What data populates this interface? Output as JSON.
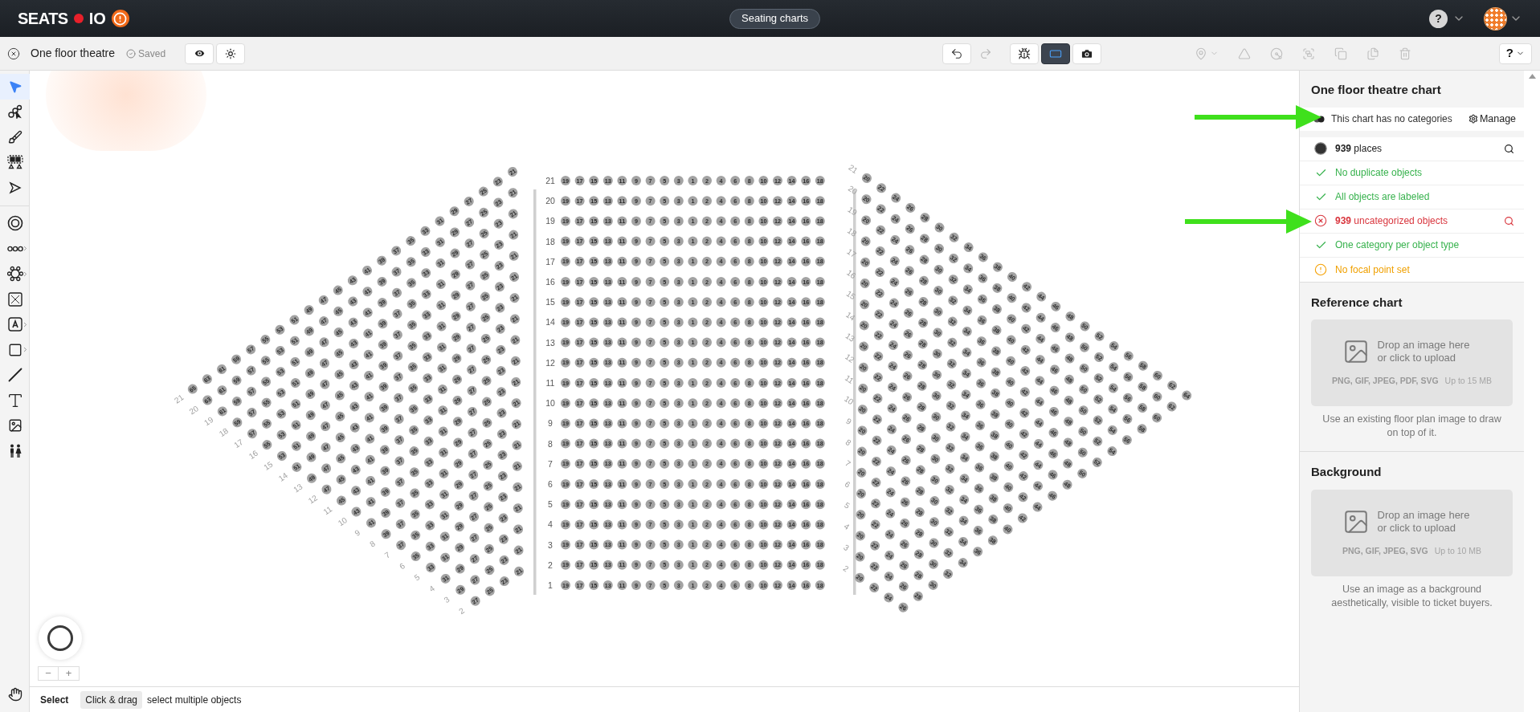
{
  "header": {
    "logo_left": "SEATS",
    "logo_right": "IO",
    "nav_tab": "Seating charts",
    "help": "?"
  },
  "toolbar": {
    "chart_name": "One floor theatre",
    "save_status": "Saved",
    "help": "?",
    "canvas_modes": [
      {
        "kind": "spark",
        "selected": false
      },
      {
        "kind": "frame",
        "selected": true
      },
      {
        "kind": "camera",
        "selected": false
      }
    ],
    "history": [
      {
        "kind": "undo",
        "disabled": false
      },
      {
        "kind": "redo",
        "disabled": true
      }
    ],
    "object_actions": [
      {
        "kind": "pin",
        "disabled": true,
        "menu": true
      },
      {
        "kind": "triangle",
        "disabled": true,
        "menu": false
      },
      {
        "kind": "fan",
        "disabled": true,
        "menu": false
      },
      {
        "kind": "group",
        "disabled": true,
        "menu": false
      },
      {
        "kind": "copy",
        "disabled": true,
        "menu": false
      },
      {
        "kind": "files",
        "disabled": true,
        "menu": false
      },
      {
        "kind": "delete",
        "disabled": true,
        "menu": false
      }
    ]
  },
  "tool_groups": [
    [
      {
        "kind": "select",
        "selected": true,
        "submenu": false
      },
      {
        "kind": "seat-select",
        "selected": false,
        "submenu": false
      },
      {
        "kind": "brush",
        "selected": false,
        "submenu": false
      },
      {
        "kind": "section-select",
        "selected": false,
        "submenu": false
      },
      {
        "kind": "node-select",
        "selected": false,
        "submenu": false
      }
    ],
    [
      {
        "kind": "round-table",
        "selected": false,
        "submenu": false
      },
      {
        "kind": "row",
        "selected": false,
        "submenu": true
      },
      {
        "kind": "table",
        "selected": false,
        "submenu": true
      },
      {
        "kind": "booth",
        "selected": false,
        "submenu": false
      },
      {
        "kind": "label",
        "selected": false,
        "submenu": true
      },
      {
        "kind": "shape",
        "selected": false,
        "submenu": true
      },
      {
        "kind": "line",
        "selected": false,
        "submenu": false
      },
      {
        "kind": "text",
        "selected": false,
        "submenu": false
      },
      {
        "kind": "image",
        "selected": false,
        "submenu": false
      },
      {
        "kind": "restroom",
        "selected": false,
        "submenu": false
      }
    ]
  ],
  "bottom_tool": {
    "kind": "hand",
    "selected": false
  },
  "sections": [
    {
      "kind": "left",
      "rows": [
        {
          "label": "21",
          "seats": [
            "65",
            "63",
            "61",
            "59",
            "57",
            "55",
            "53",
            "51",
            "49",
            "47",
            "45",
            "43",
            "41",
            "39",
            "37",
            "35",
            "33",
            "31",
            "29",
            "27",
            "25",
            "23",
            "21"
          ]
        },
        {
          "label": "20",
          "seats": [
            "63",
            "61",
            "59",
            "57",
            "55",
            "53",
            "51",
            "49",
            "47",
            "45",
            "43",
            "41",
            "39",
            "37",
            "35",
            "33",
            "31",
            "29",
            "27",
            "25",
            "23",
            "21"
          ]
        },
        {
          "label": "19",
          "seats": [
            "61",
            "59",
            "57",
            "55",
            "53",
            "51",
            "49",
            "47",
            "45",
            "43",
            "41",
            "39",
            "37",
            "35",
            "33",
            "31",
            "29",
            "27",
            "25",
            "23",
            "21"
          ]
        },
        {
          "label": "18",
          "seats": [
            "59",
            "57",
            "55",
            "53",
            "51",
            "49",
            "47",
            "45",
            "43",
            "41",
            "39",
            "37",
            "35",
            "33",
            "31",
            "29",
            "27",
            "25",
            "23",
            "21"
          ]
        },
        {
          "label": "17",
          "seats": [
            "57",
            "55",
            "53",
            "51",
            "49",
            "47",
            "45",
            "43",
            "41",
            "39",
            "37",
            "35",
            "33",
            "31",
            "29",
            "27",
            "25",
            "23",
            "21"
          ]
        },
        {
          "label": "16",
          "seats": [
            "55",
            "53",
            "51",
            "49",
            "47",
            "45",
            "43",
            "41",
            "39",
            "37",
            "35",
            "33",
            "31",
            "29",
            "27",
            "25",
            "23",
            "21"
          ]
        },
        {
          "label": "15",
          "seats": [
            "53",
            "51",
            "49",
            "47",
            "45",
            "43",
            "41",
            "39",
            "37",
            "35",
            "33",
            "31",
            "29",
            "27",
            "25",
            "23",
            "21"
          ]
        },
        {
          "label": "14",
          "seats": [
            "51",
            "49",
            "47",
            "45",
            "43",
            "41",
            "39",
            "37",
            "35",
            "33",
            "31",
            "29",
            "27",
            "25",
            "23",
            "21"
          ]
        },
        {
          "label": "13",
          "seats": [
            "49",
            "47",
            "45",
            "43",
            "41",
            "39",
            "37",
            "35",
            "33",
            "31",
            "29",
            "27",
            "25",
            "23",
            "21"
          ]
        },
        {
          "label": "12",
          "seats": [
            "47",
            "45",
            "43",
            "41",
            "39",
            "37",
            "35",
            "33",
            "31",
            "29",
            "27",
            "25",
            "23",
            "21"
          ]
        },
        {
          "label": "11",
          "seats": [
            "45",
            "43",
            "41",
            "39",
            "37",
            "35",
            "33",
            "31",
            "29",
            "27",
            "25",
            "23",
            "21"
          ]
        },
        {
          "label": "10",
          "seats": [
            "43",
            "41",
            "39",
            "37",
            "35",
            "33",
            "31",
            "29",
            "27",
            "25",
            "23",
            "21"
          ]
        },
        {
          "label": "9",
          "seats": [
            "41",
            "39",
            "37",
            "35",
            "33",
            "31",
            "29",
            "27",
            "25",
            "23",
            "21"
          ]
        },
        {
          "label": "8",
          "seats": [
            "39",
            "37",
            "35",
            "33",
            "31",
            "29",
            "27",
            "25",
            "23",
            "21"
          ]
        },
        {
          "label": "7",
          "seats": [
            "37",
            "35",
            "33",
            "31",
            "29",
            "27",
            "25",
            "23",
            "21"
          ]
        },
        {
          "label": "6",
          "seats": [
            "35",
            "33",
            "31",
            "29",
            "27",
            "25",
            "23",
            "21"
          ]
        },
        {
          "label": "5",
          "seats": [
            "33",
            "31",
            "29",
            "27",
            "25",
            "23",
            "21"
          ]
        },
        {
          "label": "4",
          "seats": [
            "31",
            "29",
            "27",
            "25",
            "23",
            "21"
          ]
        },
        {
          "label": "3",
          "seats": [
            "29",
            "27",
            "25",
            "23",
            "21"
          ]
        },
        {
          "label": "2",
          "seats": [
            "27",
            "25",
            "23",
            "21"
          ]
        }
      ]
    },
    {
      "kind": "center",
      "rows": [
        {
          "label": "21",
          "seats": [
            "19",
            "17",
            "15",
            "13",
            "11",
            "9",
            "7",
            "5",
            "3",
            "1",
            "2",
            "4",
            "6",
            "8",
            "10",
            "12",
            "14",
            "16",
            "18"
          ]
        },
        {
          "label": "20",
          "seats": [
            "19",
            "17",
            "15",
            "13",
            "11",
            "9",
            "7",
            "5",
            "3",
            "1",
            "2",
            "4",
            "6",
            "8",
            "10",
            "12",
            "14",
            "16",
            "18"
          ]
        },
        {
          "label": "19",
          "seats": [
            "19",
            "17",
            "15",
            "13",
            "11",
            "9",
            "7",
            "5",
            "3",
            "1",
            "2",
            "4",
            "6",
            "8",
            "10",
            "12",
            "14",
            "16",
            "18"
          ]
        },
        {
          "label": "18",
          "seats": [
            "19",
            "17",
            "15",
            "13",
            "11",
            "9",
            "7",
            "5",
            "3",
            "1",
            "2",
            "4",
            "6",
            "8",
            "10",
            "12",
            "14",
            "16",
            "18"
          ]
        },
        {
          "label": "17",
          "seats": [
            "19",
            "17",
            "15",
            "13",
            "11",
            "9",
            "7",
            "5",
            "3",
            "1",
            "2",
            "4",
            "6",
            "8",
            "10",
            "12",
            "14",
            "16",
            "18"
          ]
        },
        {
          "label": "16",
          "seats": [
            "19",
            "17",
            "15",
            "13",
            "11",
            "9",
            "7",
            "5",
            "3",
            "1",
            "2",
            "4",
            "6",
            "8",
            "10",
            "12",
            "14",
            "16",
            "18"
          ]
        },
        {
          "label": "15",
          "seats": [
            "19",
            "17",
            "15",
            "13",
            "11",
            "9",
            "7",
            "5",
            "3",
            "1",
            "2",
            "4",
            "6",
            "8",
            "10",
            "12",
            "14",
            "16",
            "18"
          ]
        },
        {
          "label": "14",
          "seats": [
            "19",
            "17",
            "15",
            "13",
            "11",
            "9",
            "7",
            "5",
            "3",
            "1",
            "2",
            "4",
            "6",
            "8",
            "10",
            "12",
            "14",
            "16",
            "18"
          ]
        },
        {
          "label": "13",
          "seats": [
            "19",
            "17",
            "15",
            "13",
            "11",
            "9",
            "7",
            "5",
            "3",
            "1",
            "2",
            "4",
            "6",
            "8",
            "10",
            "12",
            "14",
            "16",
            "18"
          ]
        },
        {
          "label": "12",
          "seats": [
            "19",
            "17",
            "15",
            "13",
            "11",
            "9",
            "7",
            "5",
            "3",
            "1",
            "2",
            "4",
            "6",
            "8",
            "10",
            "12",
            "14",
            "16",
            "18"
          ]
        },
        {
          "label": "11",
          "seats": [
            "19",
            "17",
            "15",
            "13",
            "11",
            "9",
            "7",
            "5",
            "3",
            "1",
            "2",
            "4",
            "6",
            "8",
            "10",
            "12",
            "14",
            "16",
            "18"
          ]
        },
        {
          "label": "10",
          "seats": [
            "19",
            "17",
            "15",
            "13",
            "11",
            "9",
            "7",
            "5",
            "3",
            "1",
            "2",
            "4",
            "6",
            "8",
            "10",
            "12",
            "14",
            "16",
            "18"
          ]
        },
        {
          "label": "9",
          "seats": [
            "19",
            "17",
            "15",
            "13",
            "11",
            "9",
            "7",
            "5",
            "3",
            "1",
            "2",
            "4",
            "6",
            "8",
            "10",
            "12",
            "14",
            "16",
            "18"
          ]
        },
        {
          "label": "8",
          "seats": [
            "19",
            "17",
            "15",
            "13",
            "11",
            "9",
            "7",
            "5",
            "3",
            "1",
            "2",
            "4",
            "6",
            "8",
            "10",
            "12",
            "14",
            "16",
            "18"
          ]
        },
        {
          "label": "7",
          "seats": [
            "19",
            "17",
            "15",
            "13",
            "11",
            "9",
            "7",
            "5",
            "3",
            "1",
            "2",
            "4",
            "6",
            "8",
            "10",
            "12",
            "14",
            "16",
            "18"
          ]
        },
        {
          "label": "6",
          "seats": [
            "19",
            "17",
            "15",
            "13",
            "11",
            "9",
            "7",
            "5",
            "3",
            "1",
            "2",
            "4",
            "6",
            "8",
            "10",
            "12",
            "14",
            "16",
            "18"
          ]
        },
        {
          "label": "5",
          "seats": [
            "19",
            "17",
            "15",
            "13",
            "11",
            "9",
            "7",
            "5",
            "3",
            "1",
            "2",
            "4",
            "6",
            "8",
            "10",
            "12",
            "14",
            "16",
            "18"
          ]
        },
        {
          "label": "4",
          "seats": [
            "19",
            "17",
            "15",
            "13",
            "11",
            "9",
            "7",
            "5",
            "3",
            "1",
            "2",
            "4",
            "6",
            "8",
            "10",
            "12",
            "14",
            "16",
            "18"
          ]
        },
        {
          "label": "3",
          "seats": [
            "19",
            "17",
            "15",
            "13",
            "11",
            "9",
            "7",
            "5",
            "3",
            "1",
            "2",
            "4",
            "6",
            "8",
            "10",
            "12",
            "14",
            "16",
            "18"
          ]
        },
        {
          "label": "2",
          "seats": [
            "19",
            "17",
            "15",
            "13",
            "11",
            "9",
            "7",
            "5",
            "3",
            "1",
            "2",
            "4",
            "6",
            "8",
            "10",
            "12",
            "14",
            "16",
            "18"
          ]
        },
        {
          "label": "1",
          "seats": [
            "19",
            "17",
            "15",
            "13",
            "11",
            "9",
            "7",
            "5",
            "3",
            "1",
            "2",
            "4",
            "6",
            "8",
            "10",
            "12",
            "14",
            "16",
            "18"
          ]
        }
      ]
    },
    {
      "kind": "right",
      "rows": [
        {
          "label": "21",
          "seats": [
            "20",
            "22",
            "24",
            "26",
            "28",
            "30",
            "32",
            "34",
            "36",
            "38",
            "40",
            "42",
            "44",
            "46",
            "48",
            "50",
            "52",
            "54",
            "56",
            "58",
            "60",
            "62",
            "64"
          ]
        },
        {
          "label": "20",
          "seats": [
            "20",
            "22",
            "24",
            "26",
            "28",
            "30",
            "32",
            "34",
            "36",
            "38",
            "40",
            "42",
            "44",
            "46",
            "48",
            "50",
            "52",
            "54",
            "56",
            "58",
            "60",
            "62"
          ]
        },
        {
          "label": "19",
          "seats": [
            "20",
            "22",
            "24",
            "26",
            "28",
            "30",
            "32",
            "34",
            "36",
            "38",
            "40",
            "42",
            "44",
            "46",
            "48",
            "50",
            "52",
            "54",
            "56",
            "58",
            "60"
          ]
        },
        {
          "label": "18",
          "seats": [
            "20",
            "22",
            "24",
            "26",
            "28",
            "30",
            "32",
            "34",
            "36",
            "38",
            "40",
            "42",
            "44",
            "46",
            "48",
            "50",
            "52",
            "54",
            "56",
            "58"
          ]
        },
        {
          "label": "17",
          "seats": [
            "20",
            "22",
            "24",
            "26",
            "28",
            "30",
            "32",
            "34",
            "36",
            "38",
            "40",
            "42",
            "44",
            "46",
            "48",
            "50",
            "52",
            "54",
            "56"
          ]
        },
        {
          "label": "16",
          "seats": [
            "20",
            "22",
            "24",
            "26",
            "28",
            "30",
            "32",
            "34",
            "36",
            "38",
            "40",
            "42",
            "44",
            "46",
            "48",
            "50",
            "52",
            "54"
          ]
        },
        {
          "label": "15",
          "seats": [
            "20",
            "22",
            "24",
            "26",
            "28",
            "30",
            "32",
            "34",
            "36",
            "38",
            "40",
            "42",
            "44",
            "46",
            "48",
            "50",
            "52"
          ]
        },
        {
          "label": "14",
          "seats": [
            "20",
            "22",
            "24",
            "26",
            "28",
            "30",
            "32",
            "34",
            "36",
            "38",
            "40",
            "42",
            "44",
            "46",
            "48",
            "50"
          ]
        },
        {
          "label": "13",
          "seats": [
            "20",
            "22",
            "24",
            "26",
            "28",
            "30",
            "32",
            "34",
            "36",
            "38",
            "40",
            "42",
            "44",
            "46",
            "48"
          ]
        },
        {
          "label": "12",
          "seats": [
            "20",
            "22",
            "24",
            "26",
            "28",
            "30",
            "32",
            "34",
            "36",
            "38",
            "40",
            "42",
            "44",
            "46"
          ]
        },
        {
          "label": "11",
          "seats": [
            "20",
            "22",
            "24",
            "26",
            "28",
            "30",
            "32",
            "34",
            "36",
            "38",
            "40",
            "42",
            "44"
          ]
        },
        {
          "label": "10",
          "seats": [
            "20",
            "22",
            "24",
            "26",
            "28",
            "30",
            "32",
            "34",
            "36",
            "38",
            "40",
            "42"
          ]
        },
        {
          "label": "9",
          "seats": [
            "20",
            "22",
            "24",
            "26",
            "28",
            "30",
            "32",
            "34",
            "36",
            "38",
            "40"
          ]
        },
        {
          "label": "8",
          "seats": [
            "20",
            "22",
            "24",
            "26",
            "28",
            "30",
            "32",
            "34",
            "36",
            "38"
          ]
        },
        {
          "label": "7",
          "seats": [
            "20",
            "22",
            "24",
            "26",
            "28",
            "30",
            "32",
            "34",
            "36"
          ]
        },
        {
          "label": "6",
          "seats": [
            "20",
            "22",
            "24",
            "26",
            "28",
            "30",
            "32",
            "34"
          ]
        },
        {
          "label": "5",
          "seats": [
            "20",
            "22",
            "24",
            "26",
            "28",
            "30",
            "32"
          ]
        },
        {
          "label": "4",
          "seats": [
            "20",
            "22",
            "24",
            "26",
            "28",
            "30"
          ]
        },
        {
          "label": "3",
          "seats": [
            "20",
            "22",
            "24",
            "26",
            "28"
          ]
        },
        {
          "label": "2",
          "seats": [
            "20",
            "22",
            "24",
            "26"
          ]
        }
      ]
    }
  ],
  "zoom": {
    "out": "−",
    "in": "+"
  },
  "status_bar": {
    "mode": "Select",
    "shortcut": "Click & drag",
    "description": "select multiple objects"
  },
  "panel": {
    "title": "One floor theatre chart",
    "categories": {
      "text": "This chart has no categories",
      "button": "Manage"
    },
    "checks": [
      {
        "kind": "info",
        "text": "**939** places",
        "search": true
      },
      {
        "kind": "ok",
        "text": "No duplicate objects",
        "search": false
      },
      {
        "kind": "ok",
        "text": "All objects are labeled",
        "search": false
      },
      {
        "kind": "error",
        "text": "**939** uncategorized objects",
        "search": true
      },
      {
        "kind": "ok",
        "text": "One category per object type",
        "search": false
      },
      {
        "kind": "warning",
        "text": "No focal point set",
        "search": false
      }
    ],
    "uploads": [
      {
        "title": "Reference chart",
        "drop_text": "Drop an image here or click to upload",
        "formats": "PNG, GIF, JPEG, PDF, SVG",
        "limit": "Up to 15 MB",
        "hint": "Use an existing floor plan image to draw on top of it."
      },
      {
        "title": "Background",
        "drop_text": "Drop an image here or click to upload",
        "formats": "PNG, GIF, JPEG, SVG",
        "limit": "Up to 10 MB",
        "hint": "Use an image as a background aesthetically, visible to ticket buyers."
      }
    ]
  }
}
